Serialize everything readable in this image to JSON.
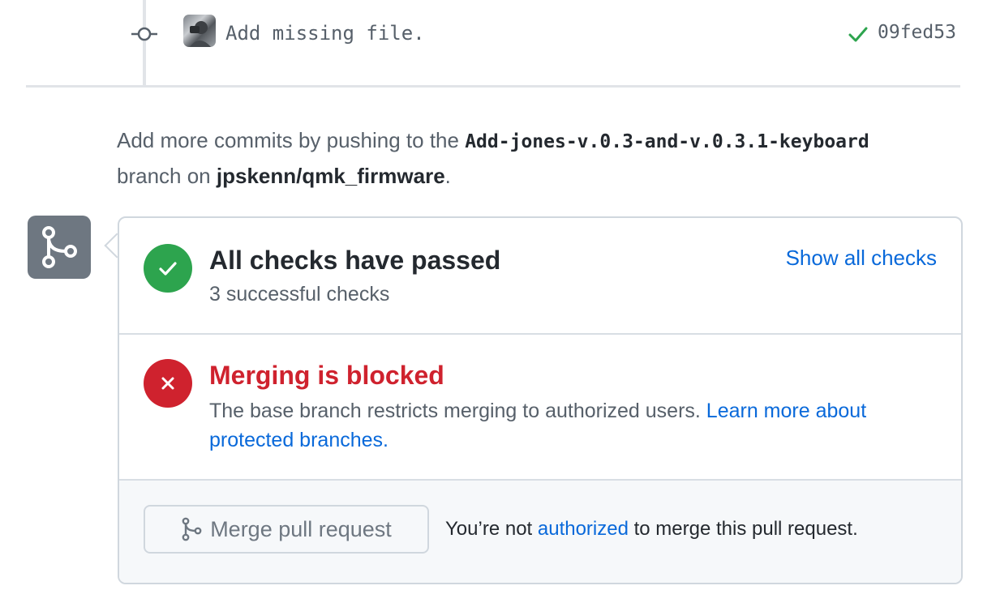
{
  "commit": {
    "message": "Add missing file.",
    "sha": "09fed53",
    "status_icon": "check-icon",
    "node_icon": "git-commit-icon"
  },
  "hint": {
    "prefix": "Add more commits by pushing to the ",
    "branch": "Add-jones-v.0.3-and-v.0.3.1-keyboard",
    "middle": " branch on ",
    "repo": "jpskenn/qmk_firmware",
    "suffix": "."
  },
  "merge_box": {
    "badge_icon": "git-merge-icon",
    "checks": {
      "title": "All checks have passed",
      "subtitle": "3 successful checks",
      "link": "Show all checks",
      "icon": "check-icon"
    },
    "blocked": {
      "title": "Merging is blocked",
      "description": "The base branch restricts merging to authorized users. ",
      "link": "Learn more about protected branches.",
      "icon": "x-icon"
    },
    "action": {
      "button_label": "Merge pull request",
      "note_prefix": "You’re not ",
      "note_link": "authorized",
      "note_suffix": " to merge this pull request."
    }
  },
  "colors": {
    "success": "#2da44e",
    "danger": "#cf222e",
    "link": "#0969da",
    "badge": "#6e7781"
  }
}
